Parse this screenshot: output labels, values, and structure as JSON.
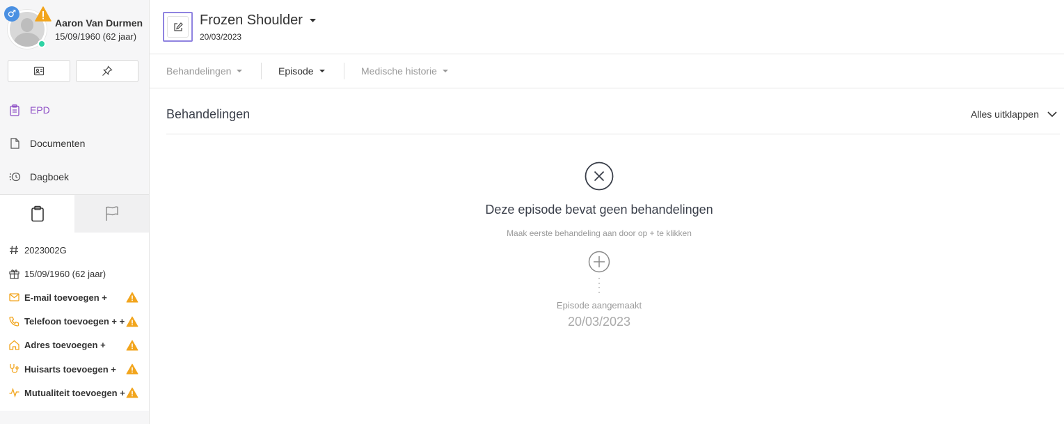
{
  "patient": {
    "name": "Aaron Van Durmen",
    "dob": "15/09/1960 (62 jaar)",
    "gender_symbol": "♂"
  },
  "nav": {
    "items": [
      {
        "label": "EPD",
        "active": true
      },
      {
        "label": "Documenten",
        "active": false
      },
      {
        "label": "Dagboek",
        "active": false
      }
    ]
  },
  "info": {
    "id": "2023002G",
    "birthday": "15/09/1960 (62 jaar)",
    "email": "E-mail toevoegen +",
    "phone": "Telefoon toevoegen + +",
    "address": "Adres toevoegen +",
    "gp": "Huisarts toevoegen +",
    "insurance": "Mutualiteit toevoegen +"
  },
  "header": {
    "title": "Frozen Shoulder",
    "date": "20/03/2023"
  },
  "subnav": {
    "treatments": "Behandelingen",
    "episode": "Episode",
    "history": "Medische historie"
  },
  "section": {
    "title": "Behandelingen",
    "expand_label": "Alles uitklappen"
  },
  "empty": {
    "title": "Deze episode bevat geen behandelingen",
    "hint": "Maak eerste behandeling aan door op + te klikken",
    "created_label": "Episode aangemaakt",
    "created_date": "20/03/2023"
  },
  "colors": {
    "accent": "#8e4fc6",
    "warning": "#f2a51d",
    "online": "#2ed3a4",
    "gender": "#4a90e2",
    "focus_border": "#8f83e0"
  }
}
